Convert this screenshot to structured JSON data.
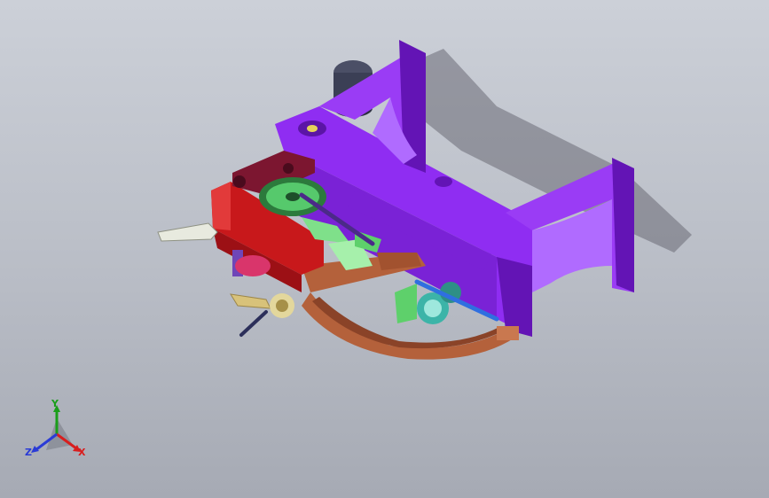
{
  "viewport": {
    "background_top": "#ccd0d8",
    "background_bottom": "#a6aab4"
  },
  "model": {
    "colors": {
      "frame": "#8f2df2",
      "frame_dark": "#6314b5",
      "frame_light": "#b06bff",
      "red_block": "#c8181b",
      "maroon_bracket": "#7c1630",
      "copper_arm": "#b4613b",
      "green_parts": "#7fe08a",
      "teal_motor": "#3cb4a8",
      "blue_rod": "#2f6fe0",
      "dark_motor": "#3b3f55",
      "white_lever": "#e8eadf",
      "brass_lever": "#d8c27a"
    }
  },
  "triad": {
    "x_label": "X",
    "y_label": "Y",
    "z_label": "Z",
    "x_color": "#d81e1e",
    "y_color": "#1a9e1a",
    "z_color": "#2a3bd6"
  }
}
